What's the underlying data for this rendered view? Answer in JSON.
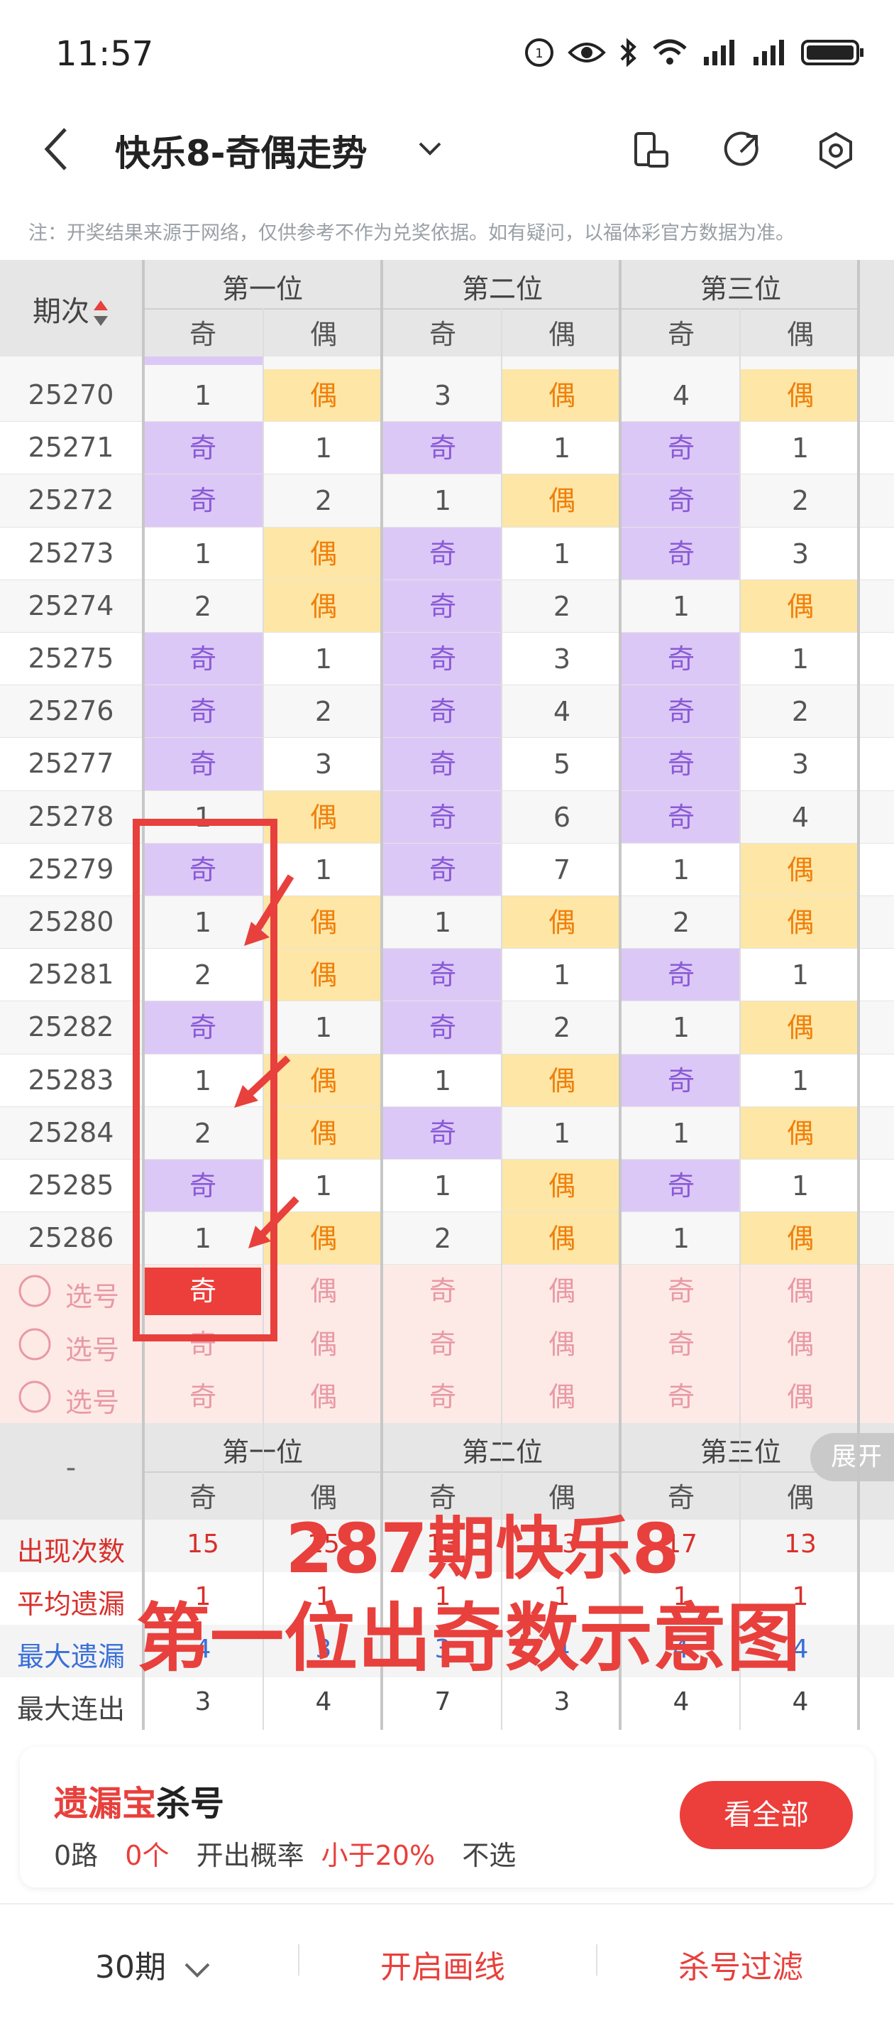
{
  "status": {
    "time": "11:57"
  },
  "nav": {
    "title": "快乐8-奇偶走势"
  },
  "note": "注：开奖结果来源于网络，仅供参考不作为兑奖依据。如有疑问，以福体彩官方数据为准。",
  "table": {
    "period_header": "期次",
    "groups": [
      "第一位",
      "第二位",
      "第三位"
    ],
    "odd": "奇",
    "even": "偶",
    "rows": [
      {
        "p": "25270",
        "c": [
          "1",
          "偶",
          "3",
          "偶",
          "4",
          "偶"
        ]
      },
      {
        "p": "25271",
        "c": [
          "奇",
          "1",
          "奇",
          "1",
          "奇",
          "1"
        ]
      },
      {
        "p": "25272",
        "c": [
          "奇",
          "2",
          "1",
          "偶",
          "奇",
          "2"
        ]
      },
      {
        "p": "25273",
        "c": [
          "1",
          "偶",
          "奇",
          "1",
          "奇",
          "3"
        ]
      },
      {
        "p": "25274",
        "c": [
          "2",
          "偶",
          "奇",
          "2",
          "1",
          "偶"
        ]
      },
      {
        "p": "25275",
        "c": [
          "奇",
          "1",
          "奇",
          "3",
          "奇",
          "1"
        ]
      },
      {
        "p": "25276",
        "c": [
          "奇",
          "2",
          "奇",
          "4",
          "奇",
          "2"
        ]
      },
      {
        "p": "25277",
        "c": [
          "奇",
          "3",
          "奇",
          "5",
          "奇",
          "3"
        ]
      },
      {
        "p": "25278",
        "c": [
          "1",
          "偶",
          "奇",
          "6",
          "奇",
          "4"
        ]
      },
      {
        "p": "25279",
        "c": [
          "奇",
          "1",
          "奇",
          "7",
          "1",
          "偶"
        ]
      },
      {
        "p": "25280",
        "c": [
          "1",
          "偶",
          "1",
          "偶",
          "2",
          "偶"
        ]
      },
      {
        "p": "25281",
        "c": [
          "2",
          "偶",
          "奇",
          "1",
          "奇",
          "1"
        ]
      },
      {
        "p": "25282",
        "c": [
          "奇",
          "1",
          "奇",
          "2",
          "1",
          "偶"
        ]
      },
      {
        "p": "25283",
        "c": [
          "1",
          "偶",
          "1",
          "偶",
          "奇",
          "1"
        ]
      },
      {
        "p": "25284",
        "c": [
          "2",
          "偶",
          "奇",
          "1",
          "1",
          "偶"
        ]
      },
      {
        "p": "25285",
        "c": [
          "奇",
          "1",
          "1",
          "偶",
          "奇",
          "1"
        ]
      },
      {
        "p": "25286",
        "c": [
          "1",
          "偶",
          "2",
          "偶",
          "1",
          "偶"
        ]
      }
    ],
    "pick_label": "选号",
    "stats_dash": "-",
    "stats": [
      {
        "label": "出现次数",
        "color": "#d9302c",
        "vals": [
          "15",
          "15",
          "13",
          "13",
          "17",
          "13"
        ]
      },
      {
        "label": "平均遗漏",
        "color": "#d9302c",
        "vals": [
          "1",
          "1",
          "1",
          "1",
          "1",
          "1"
        ]
      },
      {
        "label": "最大遗漏",
        "color": "#3a6fd8",
        "vals": [
          "4",
          "3",
          "3",
          "4",
          "4",
          "4"
        ]
      },
      {
        "label": "最大连出",
        "color": "#444444",
        "vals": [
          "3",
          "4",
          "7",
          "3",
          "4",
          "4"
        ]
      }
    ],
    "expand_label": "展开"
  },
  "annotation": {
    "line1": "287期快乐8",
    "line2": "第一位出奇数示意图"
  },
  "kill": {
    "title_red": "遗漏宝",
    "title_black": "杀号",
    "route": "0路",
    "count": "0个",
    "prob_label": "开出概率",
    "prob_value": "小于20%",
    "action": "不选",
    "button": "看全部"
  },
  "bottom": {
    "periods": "30期",
    "draw_line": "开启画线",
    "filter": "杀号过滤"
  },
  "colors": {
    "odd_bg": "#dcc8f6",
    "even_bg": "#fde6a6",
    "accent_red": "#e8403c",
    "pick_bg": "#fdeae6"
  }
}
